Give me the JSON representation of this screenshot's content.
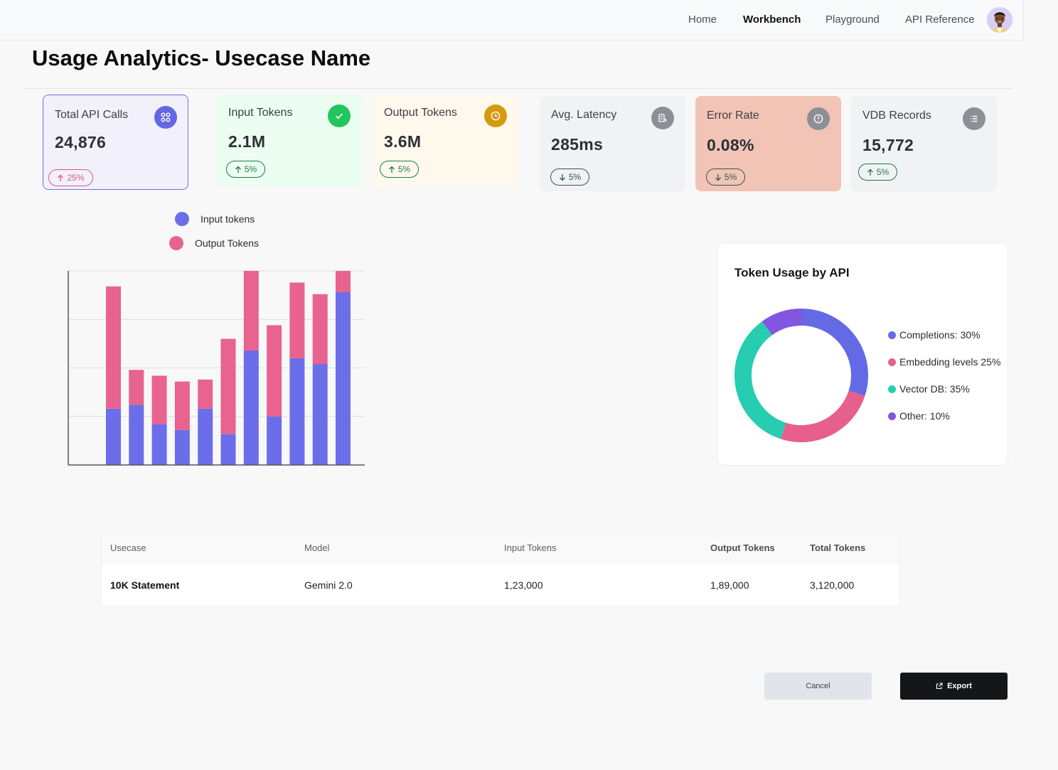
{
  "nav": {
    "links": [
      "Home",
      "Workbench",
      "Playground",
      "API Reference"
    ],
    "active": "Workbench"
  },
  "page": {
    "title": "Usage Analytics- Usecase Name"
  },
  "cards": [
    {
      "label": "Total API Calls",
      "value": "24,876",
      "change": "25%",
      "direction": "up",
      "icon": "grid-icon"
    },
    {
      "label": "Input Tokens",
      "value": "2.1M",
      "change": "5%",
      "direction": "up",
      "icon": "check-icon"
    },
    {
      "label": "Output Tokens",
      "value": "3.6M",
      "change": "5%",
      "direction": "up",
      "icon": "clock-icon"
    },
    {
      "label": "Avg. Latency",
      "value": "285ms",
      "change": "5%",
      "direction": "down",
      "icon": "server-icon"
    },
    {
      "label": "Error Rate",
      "value": "0.08%",
      "change": "5%",
      "direction": "down",
      "icon": "alert-circle-icon"
    },
    {
      "label": "VDB Records",
      "value": "15,772",
      "change": "5%",
      "direction": "up",
      "icon": "list-icon"
    }
  ],
  "colors": {
    "input": "#6b6ee8",
    "output": "#e8638f",
    "completions": "#6469e6",
    "embedding": "#e75f8c",
    "vectordb": "#27cdb0",
    "other": "#8355e0"
  },
  "chart_data": [
    {
      "type": "bar",
      "stacked": true,
      "series": [
        {
          "name": "Input tokens",
          "values": [
            29,
            31,
            21,
            18,
            29,
            16,
            59,
            25,
            55,
            52,
            89
          ]
        },
        {
          "name": "Output Tokens",
          "values": [
            63,
            18,
            25,
            25,
            15,
            49,
            51,
            47,
            39,
            36,
            21
          ]
        }
      ],
      "ylim": [
        0,
        100
      ],
      "grid": true,
      "legend": "top-left"
    },
    {
      "type": "pie",
      "donut": true,
      "title": "Token Usage by API",
      "labels": [
        "Completions: 30%",
        "Embedding levels 25%",
        "Vector DB: 35%",
        "Other: 10%"
      ],
      "values": [
        30,
        25,
        35,
        10
      ],
      "legend": "right"
    }
  ],
  "table": {
    "headers": [
      "Usecase",
      "Model",
      "Input Tokens",
      "Output Tokens",
      "Total Tokens"
    ],
    "rows": [
      [
        "10K Statement",
        "Gemini 2.0",
        "1,23,000",
        "1,89,000",
        "3,120,000"
      ]
    ]
  },
  "buttons": {
    "cancel": "Cancel",
    "export": "Export"
  }
}
